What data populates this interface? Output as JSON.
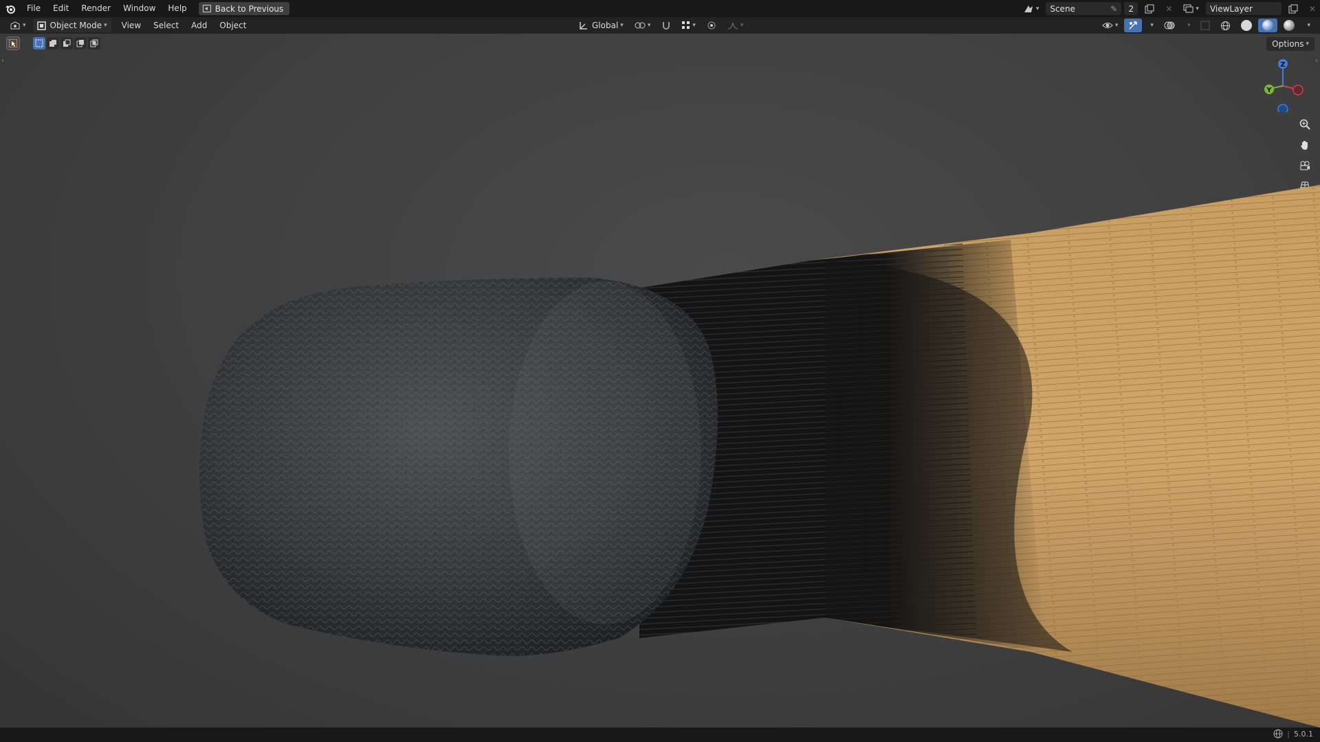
{
  "topbar": {
    "menu": [
      "File",
      "Edit",
      "Render",
      "Window",
      "Help"
    ],
    "back_label": "Back to Previous",
    "scene_name": "Scene",
    "scene_count": "2",
    "view_layer": "ViewLayer"
  },
  "header": {
    "mode": "Object Mode",
    "menus": [
      "View",
      "Select",
      "Add",
      "Object"
    ],
    "transform_orientation": "Global"
  },
  "viewport": {
    "options_label": "Options",
    "gizmo": {
      "z": "Z",
      "y": "Y"
    }
  },
  "statusbar": {
    "version": "5.0.1"
  },
  "colors": {
    "accent": "#4772b3",
    "axis_x": "#d23c4c",
    "axis_y": "#7cb82f",
    "axis_z": "#3d7ee0"
  }
}
